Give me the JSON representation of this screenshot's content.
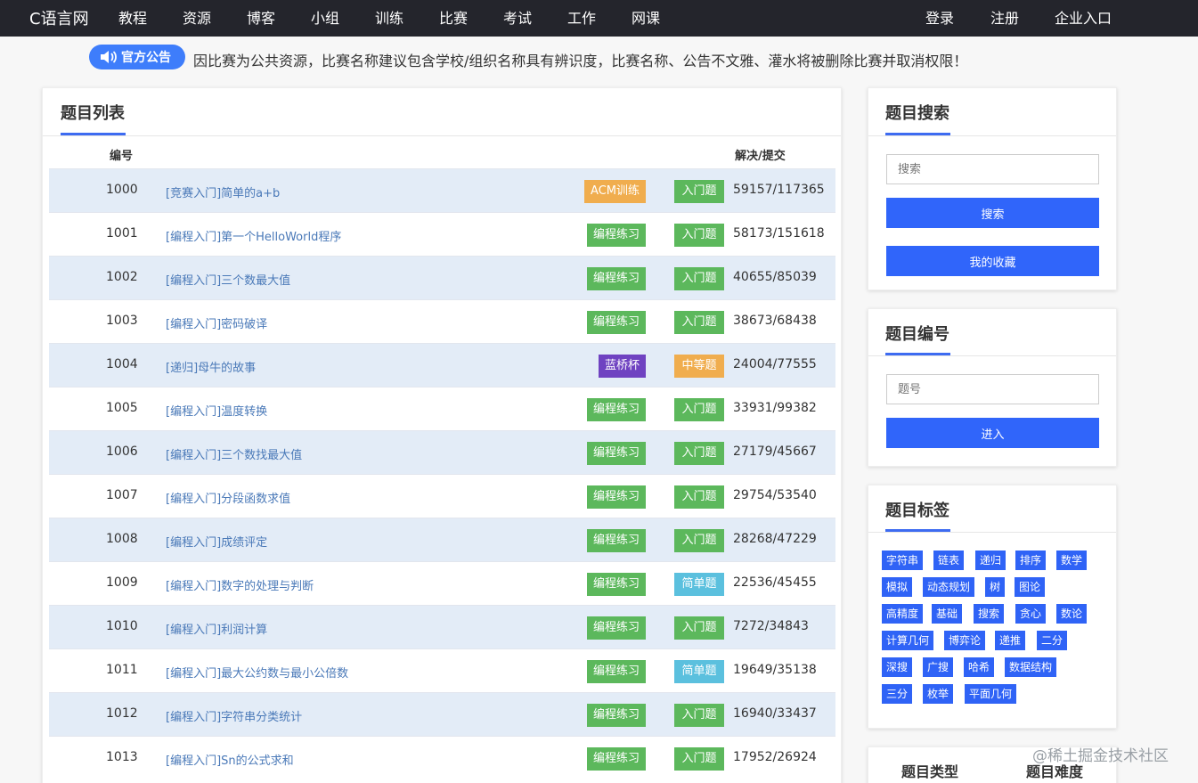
{
  "nav": {
    "logo": "C语言网",
    "items": [
      "教程",
      "资源",
      "博客",
      "小组",
      "训练",
      "比赛",
      "考试",
      "工作",
      "网课"
    ],
    "right": [
      "登录",
      "注册",
      "企业入口"
    ]
  },
  "notice": {
    "badge": "官方公告",
    "text": "因比赛为公共资源，比赛名称建议包含学校/组织名称具有辨识度，比赛名称、公告不文雅、灌水将被删除比赛并取消权限！"
  },
  "problem_list": {
    "title": "题目列表",
    "headers": {
      "id": "编号",
      "stat": "解决/提交"
    },
    "rows": [
      {
        "id": "1000",
        "title": "[竞赛入门]简单的a+b",
        "category": "ACM训练",
        "difficulty": "入门题",
        "stat": "59157/117365"
      },
      {
        "id": "1001",
        "title": "[编程入门]第一个HelloWorld程序",
        "category": "编程练习",
        "difficulty": "入门题",
        "stat": "58173/151618"
      },
      {
        "id": "1002",
        "title": "[编程入门]三个数最大值",
        "category": "编程练习",
        "difficulty": "入门题",
        "stat": "40655/85039"
      },
      {
        "id": "1003",
        "title": "[编程入门]密码破译",
        "category": "编程练习",
        "difficulty": "入门题",
        "stat": "38673/68438"
      },
      {
        "id": "1004",
        "title": "[递归]母牛的故事",
        "category": "蓝桥杯",
        "difficulty": "中等题",
        "stat": "24004/77555"
      },
      {
        "id": "1005",
        "title": "[编程入门]温度转换",
        "category": "编程练习",
        "difficulty": "入门题",
        "stat": "33931/99382"
      },
      {
        "id": "1006",
        "title": "[编程入门]三个数找最大值",
        "category": "编程练习",
        "difficulty": "入门题",
        "stat": "27179/45667"
      },
      {
        "id": "1007",
        "title": "[编程入门]分段函数求值",
        "category": "编程练习",
        "difficulty": "入门题",
        "stat": "29754/53540"
      },
      {
        "id": "1008",
        "title": "[编程入门]成绩评定",
        "category": "编程练习",
        "difficulty": "入门题",
        "stat": "28268/47229"
      },
      {
        "id": "1009",
        "title": "[编程入门]数字的处理与判断",
        "category": "编程练习",
        "difficulty": "简单题",
        "stat": "22536/45455"
      },
      {
        "id": "1010",
        "title": "[编程入门]利润计算",
        "category": "编程练习",
        "difficulty": "入门题",
        "stat": "7272/34843"
      },
      {
        "id": "1011",
        "title": "[编程入门]最大公约数与最小公倍数",
        "category": "编程练习",
        "difficulty": "简单题",
        "stat": "19649/35138"
      },
      {
        "id": "1012",
        "title": "[编程入门]字符串分类统计",
        "category": "编程练习",
        "difficulty": "入门题",
        "stat": "16940/33437"
      },
      {
        "id": "1013",
        "title": "[编程入门]Sn的公式求和",
        "category": "编程练习",
        "difficulty": "入门题",
        "stat": "17952/26924"
      }
    ]
  },
  "colors": {
    "ACM训练": "#f0ad4e",
    "编程练习": "#5cb85c",
    "蓝桥杯": "#6f42c1",
    "入门题": "#5cb85c",
    "中等题": "#f0ad4e",
    "简单题": "#5bc0de"
  },
  "search": {
    "title": "题目搜索",
    "placeholder": "搜索",
    "button": "搜索",
    "favorites": "我的收藏"
  },
  "number": {
    "title": "题目编号",
    "placeholder": "题号",
    "button": "进入"
  },
  "tags": {
    "title": "题目标签",
    "items": [
      "字符串",
      "链表",
      "递归",
      "排序",
      "数学",
      "模拟",
      "动态规划",
      "树",
      "图论",
      "高精度",
      "基础",
      "搜索",
      "贪心",
      "数论",
      "计算几何",
      "博弈论",
      "递推",
      "二分",
      "深搜",
      "广搜",
      "哈希",
      "数据结构",
      "三分",
      "枚举",
      "平面几何"
    ]
  },
  "bottom_panel": {
    "type_label": "题目类型",
    "difficulty_label": "题目难度"
  },
  "watermark": "@稀土掘金技术社区"
}
